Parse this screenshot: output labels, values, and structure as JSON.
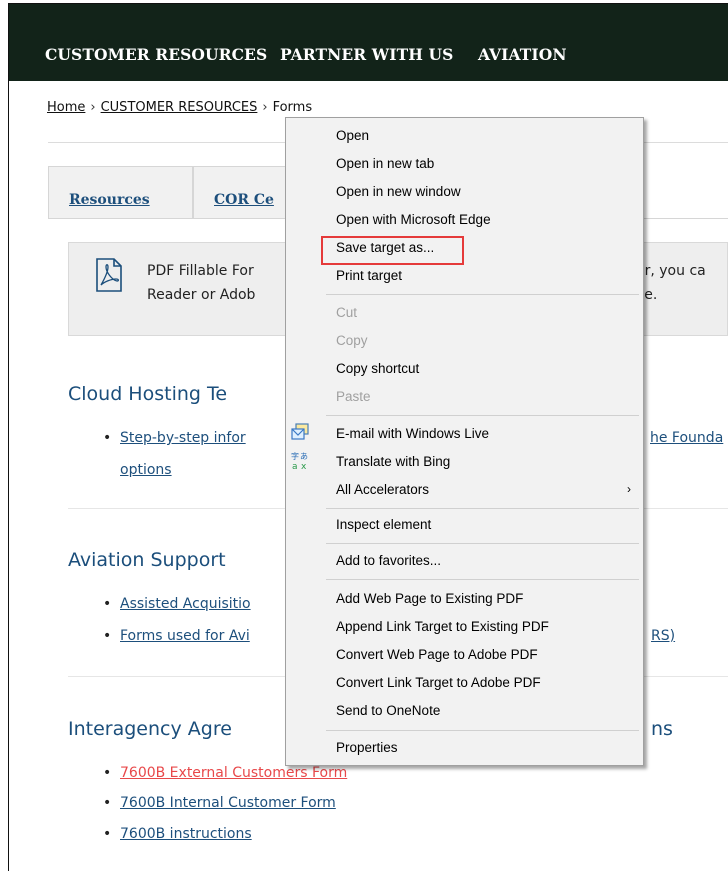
{
  "nav": {
    "items": [
      "CUSTOMER RESOURCES",
      "PARTNER WITH US",
      "AVIATION"
    ]
  },
  "breadcrumb": {
    "home": "Home",
    "section": "CUSTOMER RESOURCES",
    "current": "Forms",
    "separator": "›"
  },
  "tabs": [
    "Resources",
    "COR Ce"
  ],
  "notice": {
    "line1_left": "PDF Fillable For",
    "line2_left": "Reader or Adob",
    "line1_right": "er, you ca",
    "line2_right": "ve."
  },
  "sections": [
    {
      "title_left": "Cloud Hosting Te",
      "title_right": "",
      "items": [
        {
          "left": "Step-by-step infor",
          "right": "he Founda"
        },
        {
          "left": "options",
          "right": ""
        }
      ]
    },
    {
      "title_left": "Aviation Support",
      "title_right": "",
      "items": [
        {
          "left": "Assisted Acquisitio",
          "right": ""
        },
        {
          "left": "Forms used for Avi",
          "right": "RS)"
        }
      ]
    },
    {
      "title_left": "Interagency Agre",
      "title_right": "ns",
      "items": [
        {
          "left": "7600B External Customers Form"
        },
        {
          "left": "7600B Internal Customer Form"
        },
        {
          "left": "7600B instructions"
        }
      ]
    }
  ],
  "bullet": "•",
  "context_menu": {
    "items": [
      "Open",
      "Open in new tab",
      "Open in new window",
      "Open with Microsoft Edge",
      "Save target as...",
      "Print target",
      "Cut",
      "Copy",
      "Copy shortcut",
      "Paste",
      "E-mail with Windows Live",
      "Translate with Bing",
      "All Accelerators",
      "Inspect element",
      "Add to favorites...",
      "Add Web Page to Existing PDF",
      "Append Link Target to Existing PDF",
      "Convert Web Page to Adobe PDF",
      "Convert Link Target to Adobe PDF",
      "Send to OneNote",
      "Properties"
    ],
    "disabled": [
      "Cut",
      "Copy",
      "Paste"
    ],
    "highlighted": "Save target as...",
    "submenu_arrow": "›",
    "icons": [
      "email-icon",
      "translate-icon"
    ]
  },
  "colors": {
    "nav_bg": "#122319",
    "link": "#1d4f7c",
    "visited_link": "#e8484a",
    "heading": "#1b4e7b",
    "highlight_box": "#e53a3a"
  }
}
